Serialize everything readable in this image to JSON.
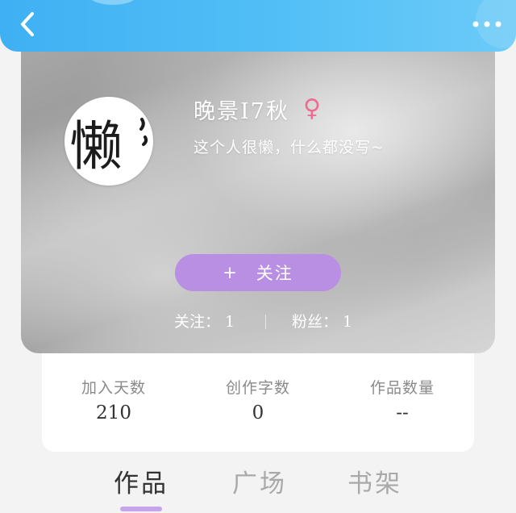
{
  "topbar": {
    "back_icon": "chevron-left-icon",
    "more_icon": "more-horizontal-icon",
    "bg_color": "#52bff6"
  },
  "profile": {
    "avatar_text": "懒",
    "username": "晚景I7秋",
    "gender_symbol": "♀",
    "gender_color": "#ee6b92",
    "bio": "这个人很懒，什么都没写~",
    "follow_plus": "+",
    "follow_label": "关注",
    "follow_color": "#b88fe3",
    "following_text": "关注： 1",
    "fans_text": "粉丝： 1"
  },
  "info": [
    {
      "label": "加入天数",
      "value": "210"
    },
    {
      "label": "创作字数",
      "value": "0"
    },
    {
      "label": "作品数量",
      "value": "--"
    }
  ],
  "tabs": [
    {
      "label": "作品",
      "active": true
    },
    {
      "label": "广场",
      "active": false
    },
    {
      "label": "书架",
      "active": false
    }
  ],
  "accent_color": "#c6a4ec"
}
